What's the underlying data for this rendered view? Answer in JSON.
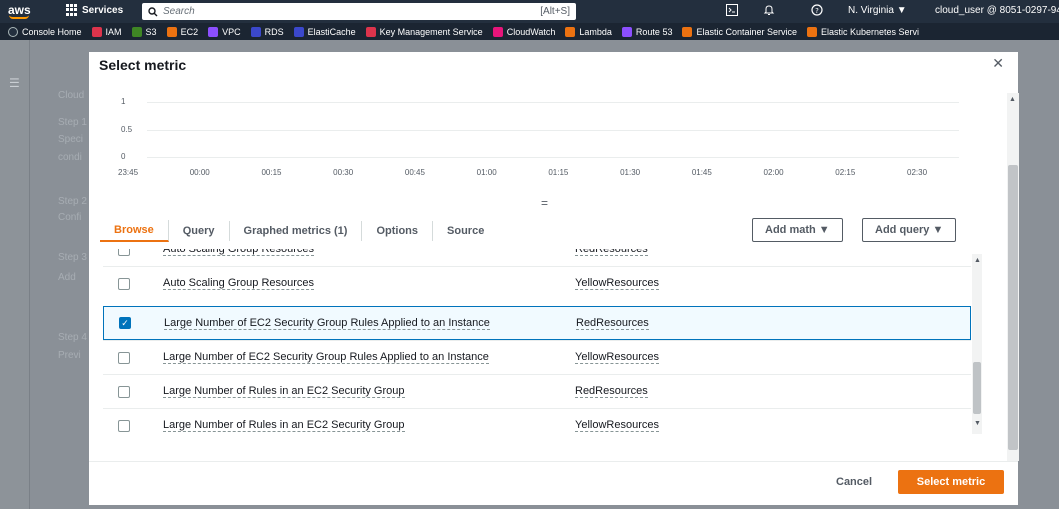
{
  "topnav": {
    "logo": "aws",
    "services": "Services",
    "search_placeholder": "Search",
    "search_shortcut": "[Alt+S]",
    "region": "N. Virginia ▼",
    "user": "cloud_user @ 8051-0297-94"
  },
  "favorites": [
    {
      "label": "Console Home",
      "color": "#232f3e"
    },
    {
      "label": "IAM",
      "color": "#dd344c"
    },
    {
      "label": "S3",
      "color": "#3f8624"
    },
    {
      "label": "EC2",
      "color": "#ec7211"
    },
    {
      "label": "VPC",
      "color": "#8c4fff"
    },
    {
      "label": "RDS",
      "color": "#3b48cc"
    },
    {
      "label": "ElastiCache",
      "color": "#3b48cc"
    },
    {
      "label": "Key Management Service",
      "color": "#dd344c"
    },
    {
      "label": "CloudWatch",
      "color": "#e7157b"
    },
    {
      "label": "Lambda",
      "color": "#ec7211"
    },
    {
      "label": "Route 53",
      "color": "#8c4fff"
    },
    {
      "label": "Elastic Container Service",
      "color": "#ec7211"
    },
    {
      "label": "Elastic Kubernetes Servi",
      "color": "#ec7211"
    }
  ],
  "background_page": {
    "items": [
      "Cloud",
      "Step 1",
      "Speci",
      "condi",
      "Step 2",
      "Confi",
      "Step 3",
      "Add",
      "Step 4",
      "Previ"
    ]
  },
  "modal": {
    "title": "Select metric",
    "close": "✕"
  },
  "chart_data": {
    "type": "line",
    "y_ticks": [
      "1",
      "0.5",
      "0"
    ],
    "x_ticks": [
      "23:45",
      "00:00",
      "00:15",
      "00:30",
      "00:45",
      "01:00",
      "01:15",
      "01:30",
      "01:45",
      "02:00",
      "02:15",
      "02:30"
    ],
    "ylim": [
      0,
      1
    ],
    "grid": true
  },
  "resize_handle": "=",
  "tabs": [
    {
      "label": "Browse",
      "active": true
    },
    {
      "label": "Query",
      "active": false
    },
    {
      "label": "Graphed metrics (1)",
      "active": false
    },
    {
      "label": "Options",
      "active": false
    },
    {
      "label": "Source",
      "active": false
    }
  ],
  "buttons": {
    "add_math": "Add math ▼",
    "add_query": "Add query ▼",
    "cancel": "Cancel",
    "select_metric": "Select metric"
  },
  "rows": [
    {
      "name": "Auto Scaling Group Resources",
      "value": "RedResources",
      "checked": false
    },
    {
      "name": "Auto Scaling Group Resources",
      "value": "YellowResources",
      "checked": false
    },
    {
      "name": "Large Number of EC2 Security Group Rules Applied to an Instance",
      "value": "RedResources",
      "checked": true
    },
    {
      "name": "Large Number of EC2 Security Group Rules Applied to an Instance",
      "value": "YellowResources",
      "checked": false
    },
    {
      "name": "Large Number of Rules in an EC2 Security Group",
      "value": "RedResources",
      "checked": false
    },
    {
      "name": "Large Number of Rules in an EC2 Security Group",
      "value": "YellowResources",
      "checked": false
    }
  ],
  "icons": {
    "cloudshell": "⊡",
    "bell": "♫",
    "help": "⊚"
  }
}
